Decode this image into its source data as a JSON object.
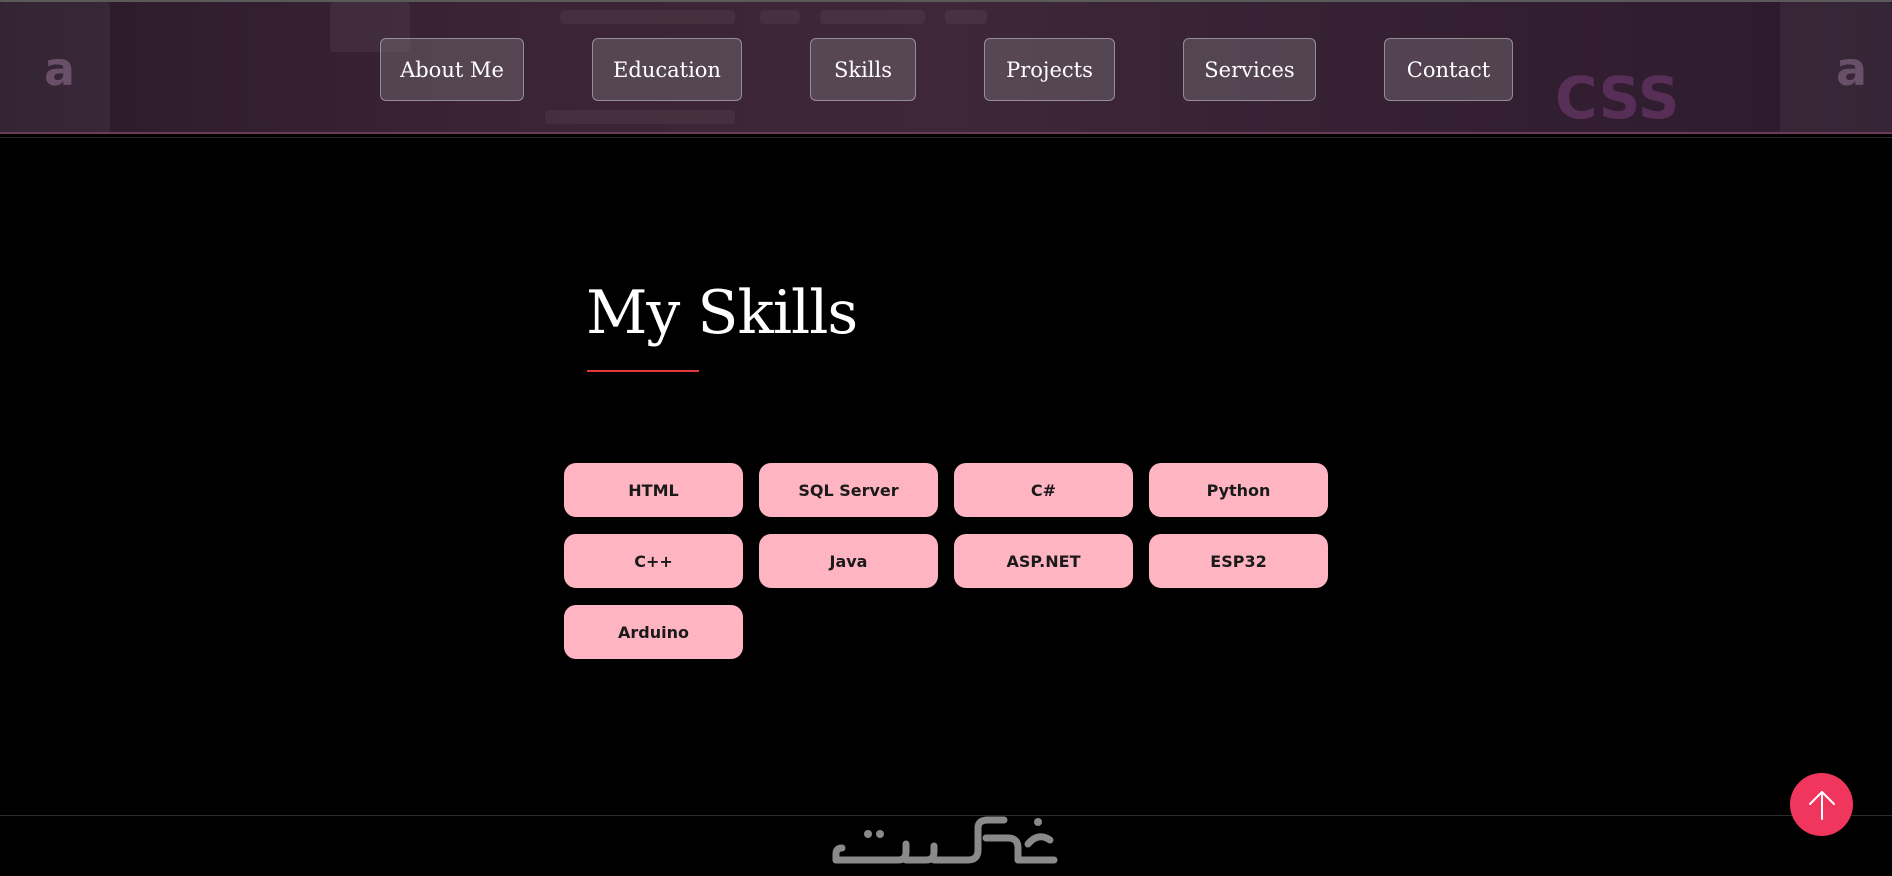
{
  "nav": {
    "items": [
      {
        "label": "About Me"
      },
      {
        "label": "Education"
      },
      {
        "label": "Skills"
      },
      {
        "label": "Projects"
      },
      {
        "label": "Services"
      },
      {
        "label": "Contact"
      }
    ]
  },
  "skills": {
    "title": "My Skills",
    "items": [
      "HTML",
      "SQL Server",
      "C#",
      "Python",
      "C++",
      "Java",
      "ASP.NET",
      "ESP32",
      "Arduino"
    ]
  },
  "footer": {
    "logo_icon": "khamsat-logo-icon"
  },
  "scroll_top": {
    "icon": "arrow-up-icon"
  },
  "colors": {
    "chip_background": "#ffb5c1",
    "accent_red": "#e23a3a",
    "scroll_button": "#f0365c",
    "page_background": "#000000"
  }
}
